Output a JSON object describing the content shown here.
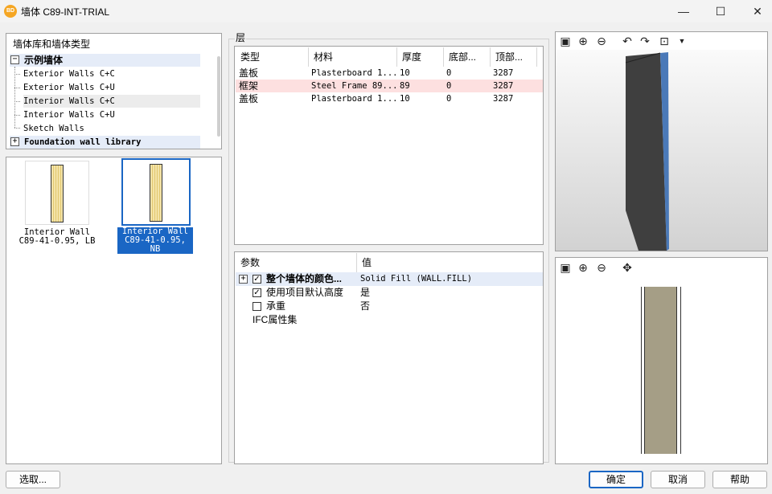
{
  "window": {
    "title": "墙体 C89-INT-TRIAL",
    "app_icon_text": "BD"
  },
  "tree": {
    "header": "墙体库和墙体类型",
    "root_label": "示例墙体",
    "items": [
      "Exterior Walls C+C",
      "Exterior Walls C+U",
      "Interior Walls C+C",
      "Interior Walls C+U",
      "Sketch Walls"
    ],
    "foundation_label": "Foundation wall library"
  },
  "thumbnails": [
    {
      "line1": "Interior Wall",
      "line2": "C89-41-0.95, LB",
      "selected": false
    },
    {
      "line1": "Interior Wall",
      "line2": "C89-41-0.95, NB",
      "selected": true
    }
  ],
  "layers": {
    "caption": "层",
    "headers": [
      "类型",
      "材料",
      "厚度",
      "底部...",
      "顶部..."
    ],
    "rows": [
      {
        "type": "盖板",
        "material": "Plasterboard 1...",
        "thickness": "10",
        "bottom": "0",
        "top": "3287"
      },
      {
        "type": "框架",
        "material": "Steel Frame 89...",
        "thickness": "89",
        "bottom": "0",
        "top": "3287"
      },
      {
        "type": "盖板",
        "material": "Plasterboard 1...",
        "thickness": "10",
        "bottom": "0",
        "top": "3287"
      }
    ]
  },
  "params": {
    "headers": [
      "参数",
      "值"
    ],
    "rows": [
      {
        "name": "整个墙体的颜色...",
        "value": "Solid Fill  (WALL.FILL)",
        "checked": true
      },
      {
        "name": "使用项目默认高度",
        "value": "是",
        "checked": true
      },
      {
        "name": "承重",
        "value": "否",
        "checked": false
      },
      {
        "name": "IFC属性集",
        "value": ""
      }
    ]
  },
  "colors": {
    "accent": "#1a66c4",
    "selected_layer": "#fde0e0",
    "wall_core": "#a59e86",
    "wall_dark": "#3f3f3f",
    "wall_edge": "#4a79b8"
  },
  "buttons": {
    "select": "选取...",
    "ok": "确定",
    "cancel": "取消",
    "help": "帮助"
  }
}
